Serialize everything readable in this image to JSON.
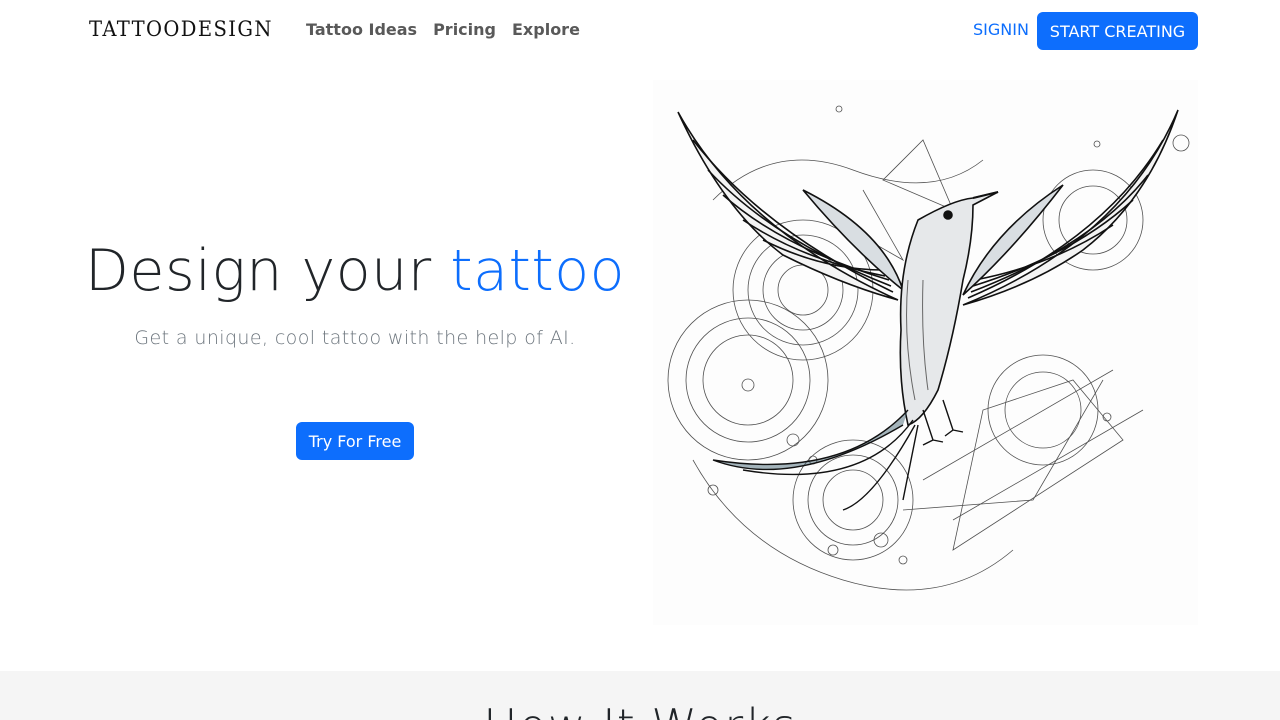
{
  "nav": {
    "brand": "TATTOODESIGN",
    "links": [
      "Tattoo Ideas",
      "Pricing",
      "Explore"
    ],
    "signin": "SIGNIN",
    "cta": "START CREATING"
  },
  "hero": {
    "title_prefix": "Design your ",
    "title_accent": "tattoo",
    "subtitle": "Get a unique, cool tattoo with the help of AI.",
    "button": "Try For Free",
    "image_icon": "bird-tattoo-illustration"
  },
  "how": {
    "title": "How It Works"
  },
  "colors": {
    "accent": "#0d6efd",
    "text": "#212529",
    "muted": "#6c757d",
    "section_bg": "#f5f5f5"
  }
}
